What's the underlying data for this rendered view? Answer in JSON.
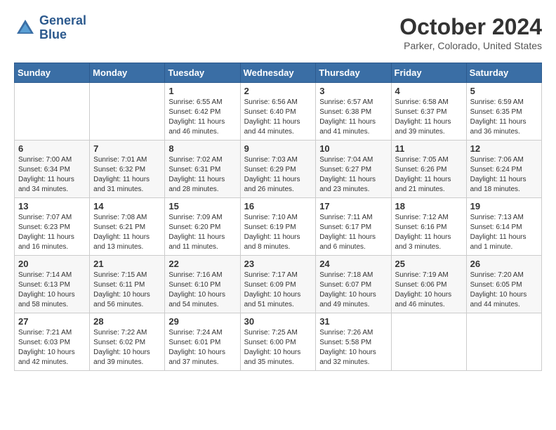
{
  "header": {
    "logo_line1": "General",
    "logo_line2": "Blue",
    "month": "October 2024",
    "location": "Parker, Colorado, United States"
  },
  "weekdays": [
    "Sunday",
    "Monday",
    "Tuesday",
    "Wednesday",
    "Thursday",
    "Friday",
    "Saturday"
  ],
  "weeks": [
    [
      {
        "day": "",
        "detail": ""
      },
      {
        "day": "",
        "detail": ""
      },
      {
        "day": "1",
        "detail": "Sunrise: 6:55 AM\nSunset: 6:42 PM\nDaylight: 11 hours and 46 minutes."
      },
      {
        "day": "2",
        "detail": "Sunrise: 6:56 AM\nSunset: 6:40 PM\nDaylight: 11 hours and 44 minutes."
      },
      {
        "day": "3",
        "detail": "Sunrise: 6:57 AM\nSunset: 6:38 PM\nDaylight: 11 hours and 41 minutes."
      },
      {
        "day": "4",
        "detail": "Sunrise: 6:58 AM\nSunset: 6:37 PM\nDaylight: 11 hours and 39 minutes."
      },
      {
        "day": "5",
        "detail": "Sunrise: 6:59 AM\nSunset: 6:35 PM\nDaylight: 11 hours and 36 minutes."
      }
    ],
    [
      {
        "day": "6",
        "detail": "Sunrise: 7:00 AM\nSunset: 6:34 PM\nDaylight: 11 hours and 34 minutes."
      },
      {
        "day": "7",
        "detail": "Sunrise: 7:01 AM\nSunset: 6:32 PM\nDaylight: 11 hours and 31 minutes."
      },
      {
        "day": "8",
        "detail": "Sunrise: 7:02 AM\nSunset: 6:31 PM\nDaylight: 11 hours and 28 minutes."
      },
      {
        "day": "9",
        "detail": "Sunrise: 7:03 AM\nSunset: 6:29 PM\nDaylight: 11 hours and 26 minutes."
      },
      {
        "day": "10",
        "detail": "Sunrise: 7:04 AM\nSunset: 6:27 PM\nDaylight: 11 hours and 23 minutes."
      },
      {
        "day": "11",
        "detail": "Sunrise: 7:05 AM\nSunset: 6:26 PM\nDaylight: 11 hours and 21 minutes."
      },
      {
        "day": "12",
        "detail": "Sunrise: 7:06 AM\nSunset: 6:24 PM\nDaylight: 11 hours and 18 minutes."
      }
    ],
    [
      {
        "day": "13",
        "detail": "Sunrise: 7:07 AM\nSunset: 6:23 PM\nDaylight: 11 hours and 16 minutes."
      },
      {
        "day": "14",
        "detail": "Sunrise: 7:08 AM\nSunset: 6:21 PM\nDaylight: 11 hours and 13 minutes."
      },
      {
        "day": "15",
        "detail": "Sunrise: 7:09 AM\nSunset: 6:20 PM\nDaylight: 11 hours and 11 minutes."
      },
      {
        "day": "16",
        "detail": "Sunrise: 7:10 AM\nSunset: 6:19 PM\nDaylight: 11 hours and 8 minutes."
      },
      {
        "day": "17",
        "detail": "Sunrise: 7:11 AM\nSunset: 6:17 PM\nDaylight: 11 hours and 6 minutes."
      },
      {
        "day": "18",
        "detail": "Sunrise: 7:12 AM\nSunset: 6:16 PM\nDaylight: 11 hours and 3 minutes."
      },
      {
        "day": "19",
        "detail": "Sunrise: 7:13 AM\nSunset: 6:14 PM\nDaylight: 11 hours and 1 minute."
      }
    ],
    [
      {
        "day": "20",
        "detail": "Sunrise: 7:14 AM\nSunset: 6:13 PM\nDaylight: 10 hours and 58 minutes."
      },
      {
        "day": "21",
        "detail": "Sunrise: 7:15 AM\nSunset: 6:11 PM\nDaylight: 10 hours and 56 minutes."
      },
      {
        "day": "22",
        "detail": "Sunrise: 7:16 AM\nSunset: 6:10 PM\nDaylight: 10 hours and 54 minutes."
      },
      {
        "day": "23",
        "detail": "Sunrise: 7:17 AM\nSunset: 6:09 PM\nDaylight: 10 hours and 51 minutes."
      },
      {
        "day": "24",
        "detail": "Sunrise: 7:18 AM\nSunset: 6:07 PM\nDaylight: 10 hours and 49 minutes."
      },
      {
        "day": "25",
        "detail": "Sunrise: 7:19 AM\nSunset: 6:06 PM\nDaylight: 10 hours and 46 minutes."
      },
      {
        "day": "26",
        "detail": "Sunrise: 7:20 AM\nSunset: 6:05 PM\nDaylight: 10 hours and 44 minutes."
      }
    ],
    [
      {
        "day": "27",
        "detail": "Sunrise: 7:21 AM\nSunset: 6:03 PM\nDaylight: 10 hours and 42 minutes."
      },
      {
        "day": "28",
        "detail": "Sunrise: 7:22 AM\nSunset: 6:02 PM\nDaylight: 10 hours and 39 minutes."
      },
      {
        "day": "29",
        "detail": "Sunrise: 7:24 AM\nSunset: 6:01 PM\nDaylight: 10 hours and 37 minutes."
      },
      {
        "day": "30",
        "detail": "Sunrise: 7:25 AM\nSunset: 6:00 PM\nDaylight: 10 hours and 35 minutes."
      },
      {
        "day": "31",
        "detail": "Sunrise: 7:26 AM\nSunset: 5:58 PM\nDaylight: 10 hours and 32 minutes."
      },
      {
        "day": "",
        "detail": ""
      },
      {
        "day": "",
        "detail": ""
      }
    ]
  ]
}
